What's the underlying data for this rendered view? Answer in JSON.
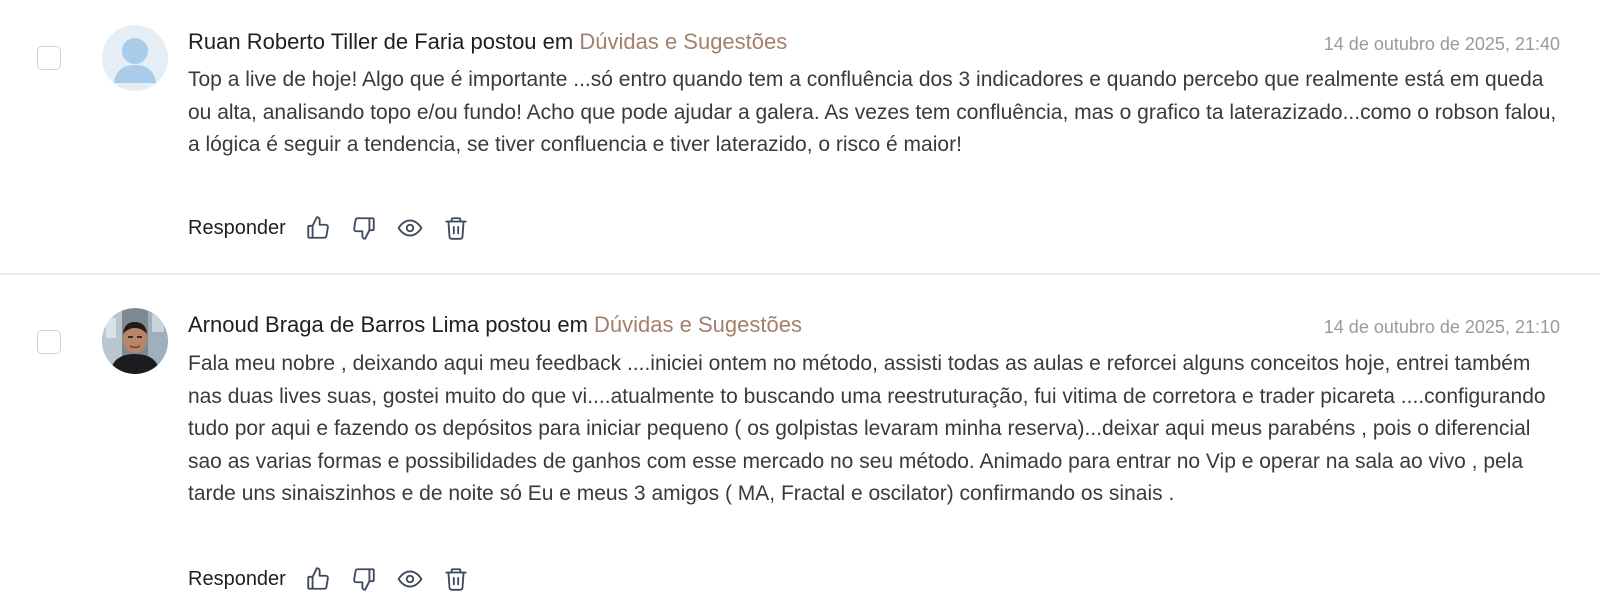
{
  "posts": [
    {
      "author": "Ruan Roberto Tiller de Faria",
      "posted_in": "postou em",
      "category": "Dúvidas e Sugestões",
      "date": "14 de outubro de 2025, 21:40",
      "avatar": "default-avatar",
      "body": "Top a live de hoje! Algo que é importante ...só entro quando tem a confluência dos 3 indicadores e quando percebo que realmente está em queda ou alta, analisando topo e/ou fundo! Acho que pode ajudar a galera. As vezes tem confluência, mas o grafico ta laterazizado...como o robson falou, a lógica é seguir a tendencia, se tiver confluencia e tiver laterazido, o risco é maior!",
      "reply_label": "Responder"
    },
    {
      "author": "Arnoud Braga de Barros Lima",
      "posted_in": "postou em",
      "category": "Dúvidas e Sugestões",
      "date": "14 de outubro de 2025, 21:10",
      "avatar": "user-photo",
      "body": "Fala meu nobre , deixando aqui meu feedback ....iniciei ontem no método, assisti todas as aulas e reforcei alguns conceitos hoje, entrei também nas duas lives suas, gostei muito do que vi....atualmente to buscando uma reestruturação, fui vitima de corretora e trader picareta ....configurando tudo por aqui e fazendo os depósitos para iniciar pequeno ( os golpistas levaram minha reserva)...deixar aqui meus parabéns , pois o diferencial sao as varias formas e possibilidades de ganhos com esse mercado no seu método. Animado para entrar no Vip e operar na sala ao vivo , pela tarde uns sinaiszinhos e de noite só Eu e meus 3 amigos ( MA, Fractal e oscilator) confirmando os sinais .",
      "reply_label": "Responder"
    }
  ],
  "action_icons": [
    "thumbs-up-icon",
    "thumbs-down-icon",
    "eye-icon",
    "trash-icon"
  ],
  "colors": {
    "category": "#a47f6c",
    "date": "#9a9a9a",
    "text": "#3a3a3a",
    "divider": "#ececec",
    "icon": "#3d4a5c"
  }
}
